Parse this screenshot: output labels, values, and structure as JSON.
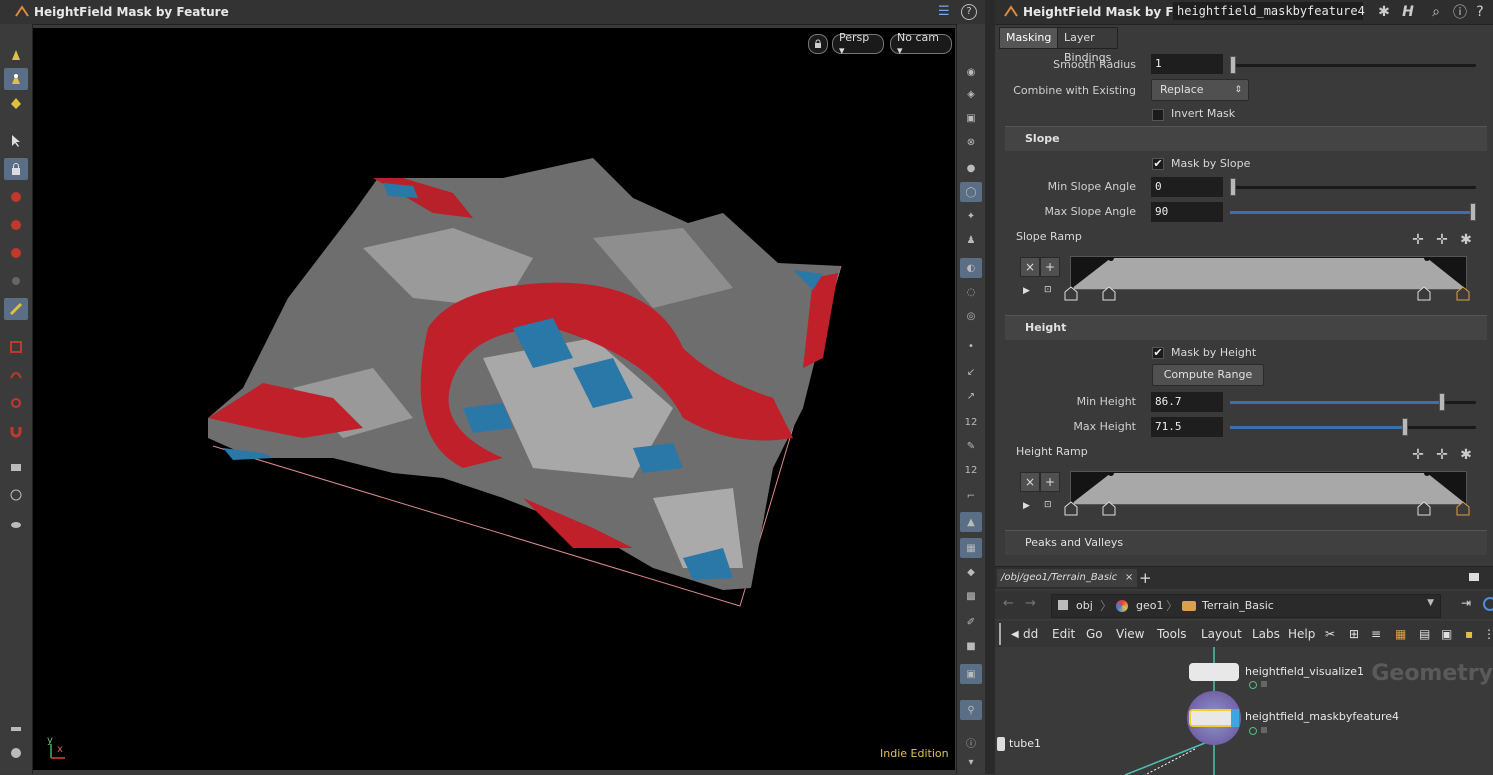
{
  "viewport": {
    "title": "HeightField Mask by Feature",
    "camera_persp": "Persp ▾",
    "camera_nocam": "No cam ▾",
    "edition": "Indie Edition",
    "axis_y": "y",
    "axis_x": "x"
  },
  "params": {
    "node_type": "HeightField Mask by Feature",
    "node_name": "heightfield_maskbyfeature4",
    "tabs": [
      "Masking",
      "Layer Bindings"
    ],
    "smooth_radius_label": "Smooth Radius",
    "smooth_radius_value": "1",
    "smooth_radius_fraction": 0.0,
    "combine_label": "Combine with Existing",
    "combine_value": "Replace",
    "invert_mask_label": "Invert Mask",
    "invert_mask_checked": false,
    "slope": {
      "title": "Slope",
      "mask_by_slope_label": "Mask by Slope",
      "mask_by_slope_checked": true,
      "min_label": "Min Slope Angle",
      "min_value": "0",
      "min_fraction": 0.0,
      "max_label": "Max Slope Angle",
      "max_value": "90",
      "max_fraction": 1.0,
      "ramp_label": "Slope Ramp"
    },
    "height": {
      "title": "Height",
      "mask_by_height_label": "Mask by Height",
      "mask_by_height_checked": true,
      "compute_range_label": "Compute Range",
      "min_label": "Min Height",
      "min_value": "86.7",
      "min_fraction": 0.86,
      "max_label": "Max Height",
      "max_value": "71.5",
      "max_fraction": 0.71,
      "ramp_label": "Height Ramp"
    },
    "peaks_label": "Peaks and Valleys"
  },
  "network": {
    "tab_label": "/obj/geo1/Terrain_Basic",
    "path": [
      "obj",
      "geo1",
      "Terrain_Basic"
    ],
    "menu": [
      "dd",
      "Edit",
      "Go",
      "View",
      "Tools",
      "Layout",
      "Labs",
      "Help"
    ],
    "watermark": "Geometry",
    "nodes": [
      "heightfield_visualize1",
      "heightfield_maskbyfeature4",
      "tube1"
    ]
  }
}
